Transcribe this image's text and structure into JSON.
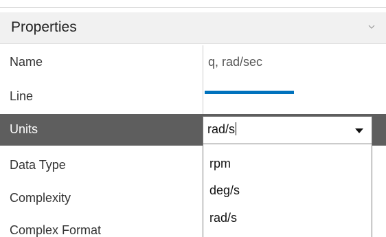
{
  "header": {
    "title": "Properties",
    "chevron_icon": "chevron-down-icon"
  },
  "rows": [
    {
      "label": "Name",
      "value": "q, rad/sec"
    },
    {
      "label": "Line"
    },
    {
      "label": "Units",
      "value": "rad/s"
    },
    {
      "label": "Data Type"
    },
    {
      "label": "Complexity"
    },
    {
      "label": "Complex Format"
    }
  ],
  "line_color": "#0072bd",
  "units_dropdown": {
    "current": "rad/s",
    "options": [
      "rpm",
      "deg/s",
      "rad/s"
    ]
  },
  "colors": {
    "header_bg": "#f1f1f1",
    "selected_row_bg": "#5e5e5e"
  }
}
